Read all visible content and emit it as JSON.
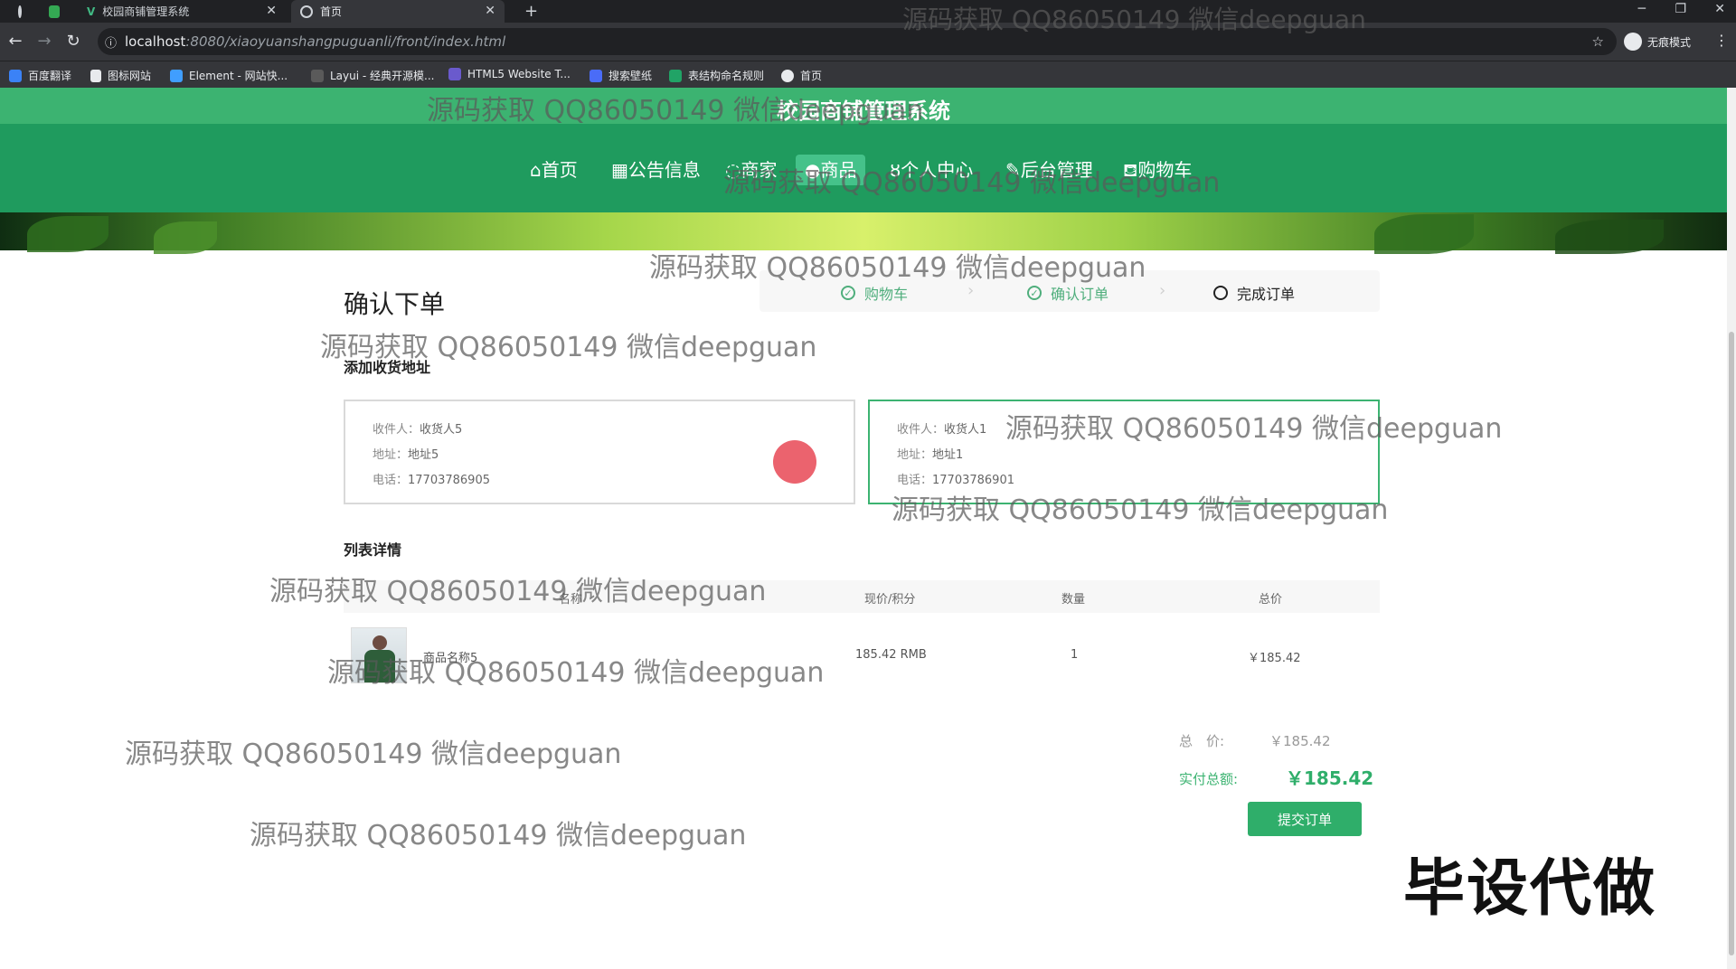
{
  "browser": {
    "tabs": [
      {
        "label": "",
        "icon": "chrome-icon"
      },
      {
        "label": "",
        "icon": "sheet-icon"
      },
      {
        "label": "校园商铺管理系统",
        "icon": "vue-icon"
      },
      {
        "label": "首页",
        "icon": "globe-icon"
      }
    ],
    "url_host": "localhost",
    "url_path": ":8080/xiaoyuanshangpuguanli/front/index.html",
    "profile_label": "无痕模式",
    "bookmarks": [
      "百度翻译",
      "图标网站",
      "Element - 网站快...",
      "Layui - 经典开源模...",
      "HTML5 Website T...",
      "搜索壁纸",
      "表结构命名规则",
      "首页"
    ]
  },
  "site": {
    "title": "校园商铺管理系统",
    "nav": [
      {
        "label": "⌂首页"
      },
      {
        "label": "▦公告信息"
      },
      {
        "label": "◌商家"
      },
      {
        "label": "●商品",
        "active": true
      },
      {
        "label": "ȣ个人中心"
      },
      {
        "label": "✎后台管理"
      },
      {
        "label": "⛾购物车"
      }
    ]
  },
  "order": {
    "heading": "确认下单",
    "steps": [
      {
        "label": "购物车",
        "state": "done"
      },
      {
        "label": "确认订单",
        "state": "done"
      },
      {
        "label": "完成订单",
        "state": "current"
      }
    ],
    "address_section": "添加收货地址",
    "addresses": [
      {
        "receiver_label": "收件人：",
        "receiver": "收货人5",
        "address_label": "地址：",
        "address": "地址5",
        "phone_label": "电话：",
        "phone": "17703786905",
        "selected": false
      },
      {
        "receiver_label": "收件人：",
        "receiver": "收货人1",
        "address_label": "地址：",
        "address": "地址1",
        "phone_label": "电话：",
        "phone": "17703786901",
        "selected": true
      }
    ],
    "list_section": "列表详情",
    "columns": [
      "名称",
      "现价/积分",
      "数量",
      "总价"
    ],
    "rows": [
      {
        "name": "商品名称5",
        "price": "185.42 RMB",
        "qty": "1",
        "total": "￥185.42"
      }
    ],
    "total_label": "总　价:",
    "total_value": "￥185.42",
    "paid_label": "实付总额:",
    "paid_value": "￥185.42",
    "submit_label": "提交订单"
  },
  "watermarks": [
    "源码获取 QQ86050149 微信deepguan"
  ],
  "stamp": "毕设代做",
  "colors": {
    "nav_green": "#1f9b5e",
    "accent_green": "#3cb371",
    "submit_green": "#2fae6a"
  }
}
